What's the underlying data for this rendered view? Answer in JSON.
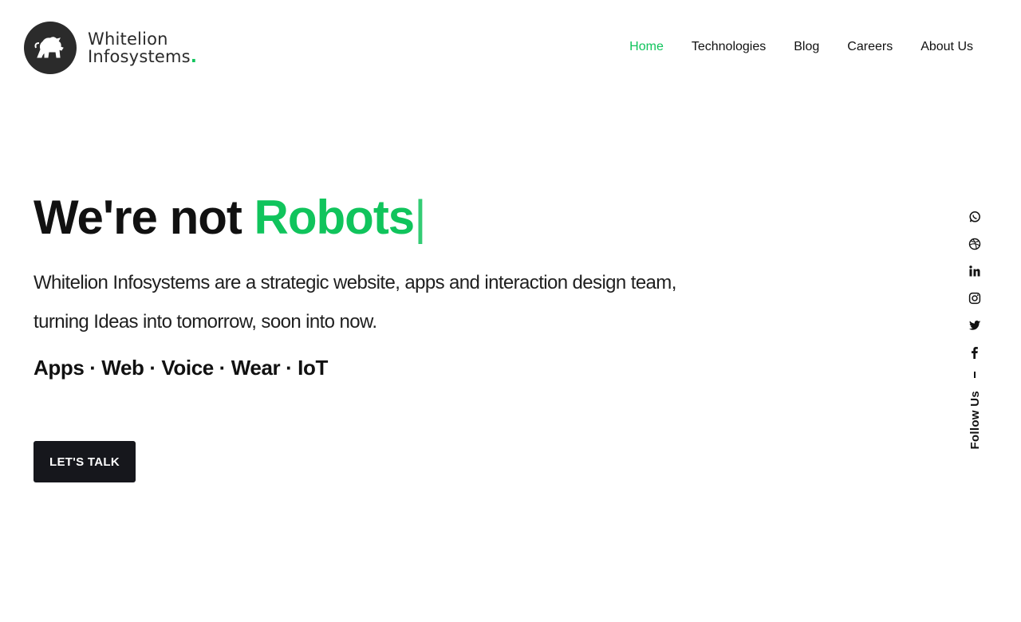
{
  "brand": {
    "line1": "Whitelion",
    "line2": "Infosystems",
    "dot": ".",
    "accent_color": "#10c45c"
  },
  "nav": {
    "items": [
      {
        "label": "Home",
        "active": true
      },
      {
        "label": "Technologies",
        "active": false
      },
      {
        "label": "Blog",
        "active": false
      },
      {
        "label": "Careers",
        "active": false
      },
      {
        "label": "About Us",
        "active": false
      }
    ]
  },
  "hero": {
    "headline_prefix": "We're not",
    "headline_accent": "Robots",
    "caret": "|",
    "subtitle_line1": "Whitelion Infosystems are a strategic website, apps and interaction design team,",
    "subtitle_line2": "turning Ideas into tomorrow, soon into now.",
    "services": "Apps · Web · Voice · Wear · IoT",
    "cta_label": "LET'S TALK"
  },
  "social": {
    "icons": [
      "whatsapp-icon",
      "dribbble-icon",
      "linkedin-icon",
      "instagram-icon",
      "twitter-icon",
      "facebook-icon"
    ],
    "follow_label": "Follow Us"
  }
}
